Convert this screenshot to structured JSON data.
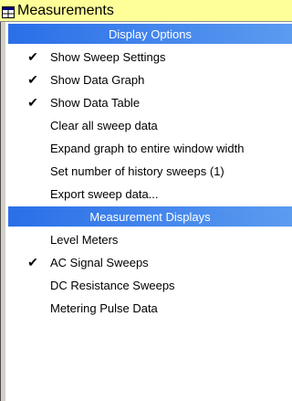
{
  "title": {
    "text": "Measurements",
    "icon": "window-icon",
    "background": "#ffff99"
  },
  "sections": [
    {
      "header": "Display Options",
      "items": [
        {
          "label": "Show Sweep Settings",
          "checked": true
        },
        {
          "label": "Show Data Graph",
          "checked": true
        },
        {
          "label": "Show Data Table",
          "checked": true
        },
        {
          "label": "Clear all sweep data",
          "checked": false
        },
        {
          "label": "Expand graph to entire window width",
          "checked": false
        },
        {
          "label": "Set number of history sweeps (1)",
          "checked": false
        },
        {
          "label": "Export sweep data...",
          "checked": false
        }
      ]
    },
    {
      "header": "Measurement Displays",
      "items": [
        {
          "label": "Level Meters",
          "checked": false
        },
        {
          "label": "AC Signal Sweeps",
          "checked": true
        },
        {
          "label": "DC Resistance Sweeps",
          "checked": false
        },
        {
          "label": "Metering Pulse Data",
          "checked": false
        }
      ]
    }
  ],
  "colors": {
    "header_start": "#2a6fe8",
    "header_end": "#5b9bf0",
    "check_icon": "check-icon"
  }
}
